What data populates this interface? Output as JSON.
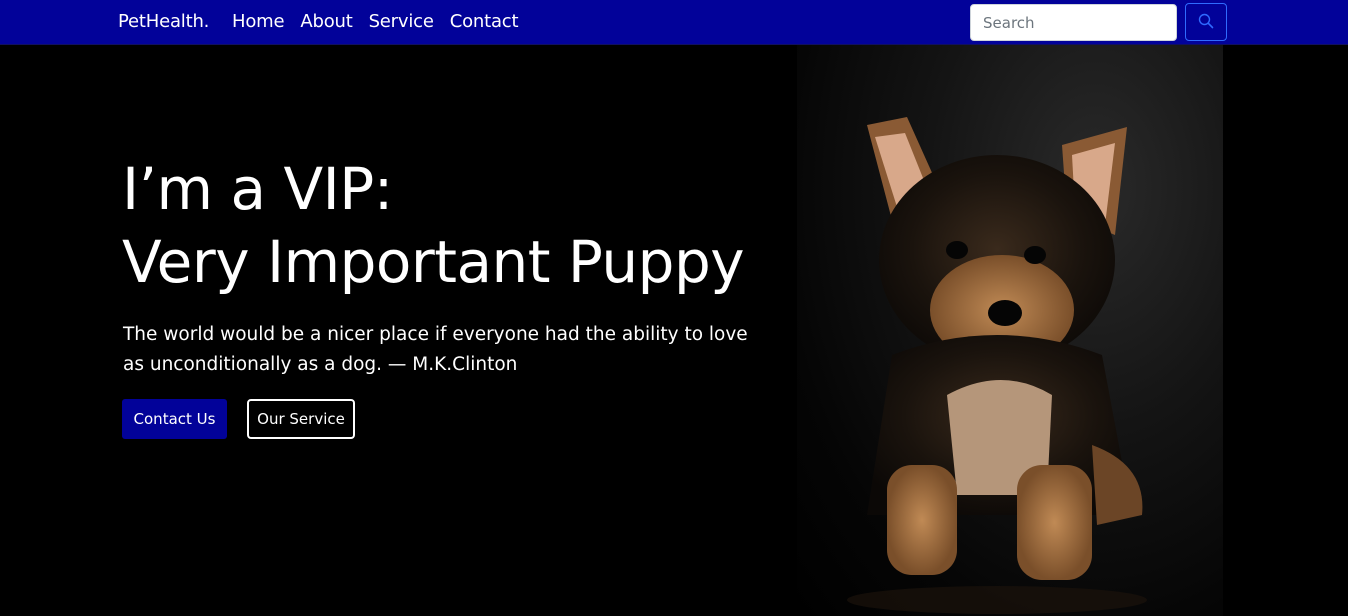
{
  "nav": {
    "brand": "PetHealth.",
    "links": [
      "Home",
      "About",
      "Service",
      "Contact"
    ],
    "search_placeholder": "Search"
  },
  "hero": {
    "headline_line1": "I’m a VIP:",
    "headline_line2": "Very Important Puppy",
    "quote": "The world would be a nicer place if everyone had the ability to love as unconditionally as a dog. — M.K.Clinton",
    "primary_button": "Contact Us",
    "secondary_button": "Our Service",
    "image_subject": "yorkshire terrier puppy"
  },
  "colors": {
    "nav_bg": "#020299",
    "primary_button_bg": "#020299",
    "search_button_border": "#2f6bff",
    "page_bg": "#000000"
  },
  "icons": {
    "search_button": "search-icon"
  }
}
